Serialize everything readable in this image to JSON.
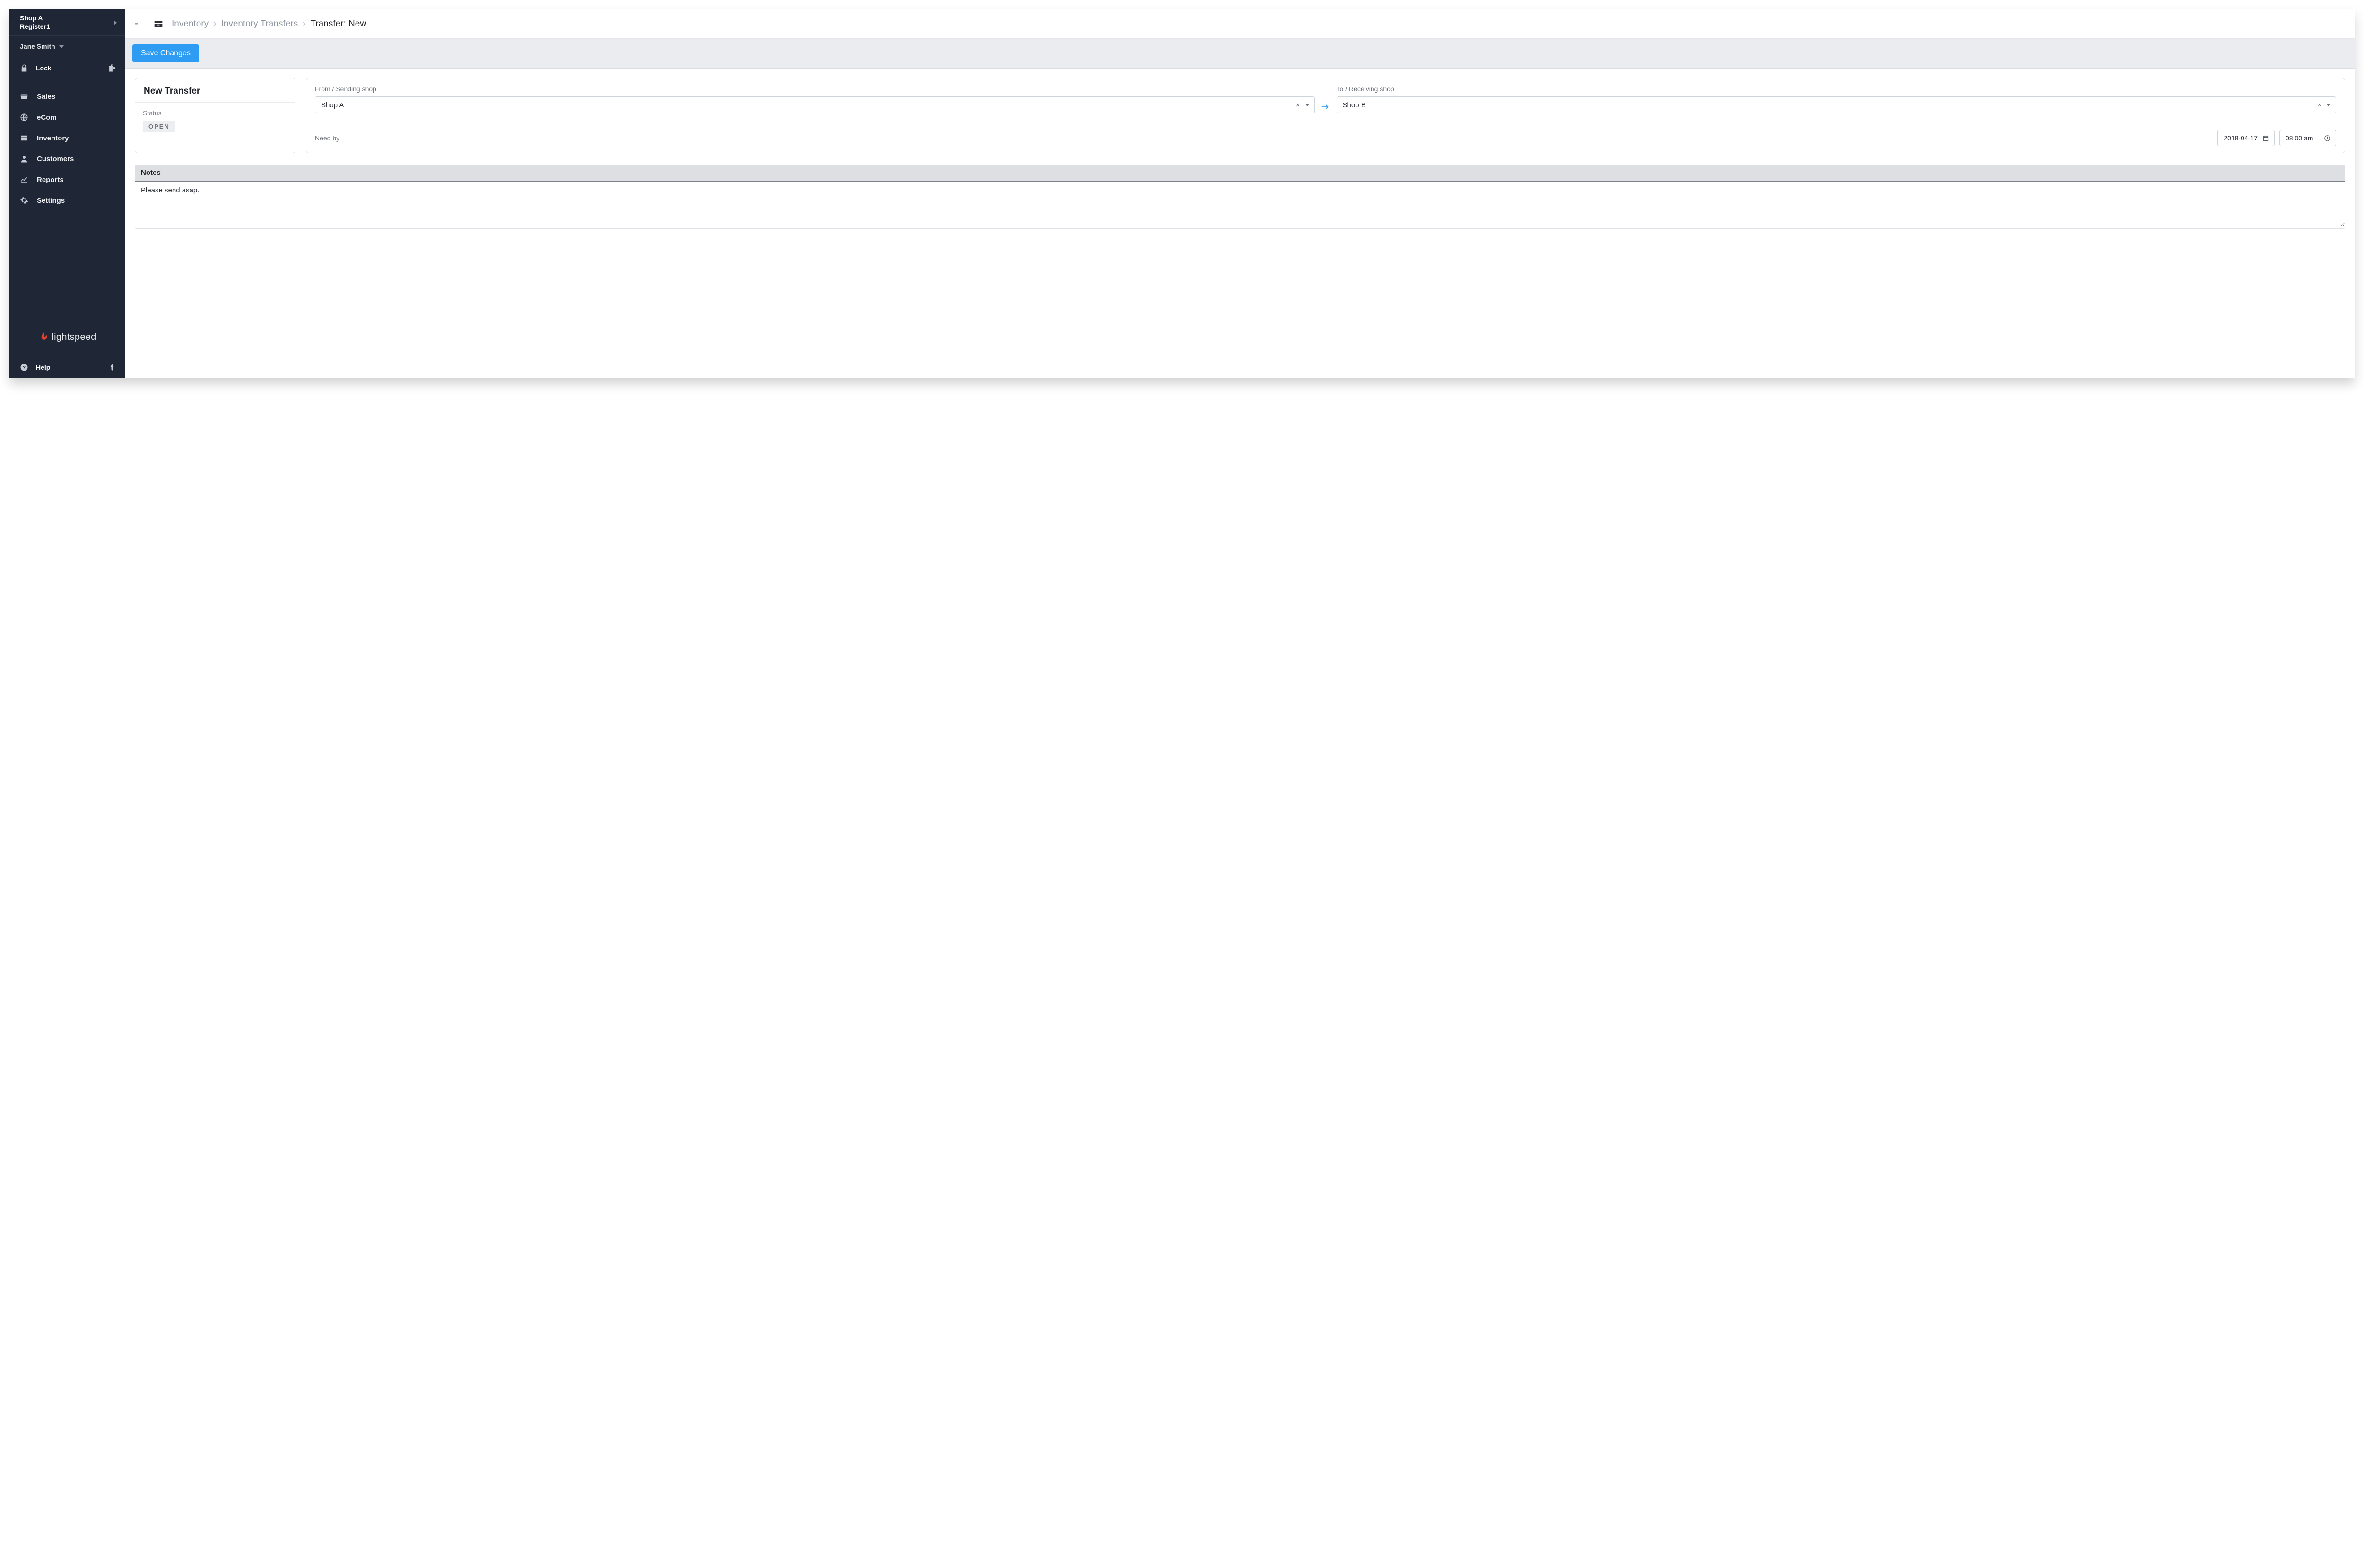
{
  "sidebar": {
    "shop_name": "Shop A",
    "register_name": "Register1",
    "user": "Jane Smith",
    "lock_label": "Lock",
    "nav": [
      {
        "label": "Sales"
      },
      {
        "label": "eCom"
      },
      {
        "label": "Inventory"
      },
      {
        "label": "Customers"
      },
      {
        "label": "Reports"
      },
      {
        "label": "Settings"
      }
    ],
    "brand": "lightspeed",
    "help_label": "Help"
  },
  "breadcrumb": {
    "root": "Inventory",
    "section": "Inventory Transfers",
    "current": "Transfer: New"
  },
  "actions": {
    "save": "Save Changes"
  },
  "transfer": {
    "title": "New Transfer",
    "status_label": "Status",
    "status_value": "OPEN",
    "from_label": "From / Sending shop",
    "from_value": "Shop A",
    "to_label": "To / Receiving shop",
    "to_value": "Shop B",
    "needby_label": "Need by",
    "needby_date": "2018-04-17",
    "needby_time": "08:00 am"
  },
  "notes": {
    "heading": "Notes",
    "value": "Please send asap."
  }
}
